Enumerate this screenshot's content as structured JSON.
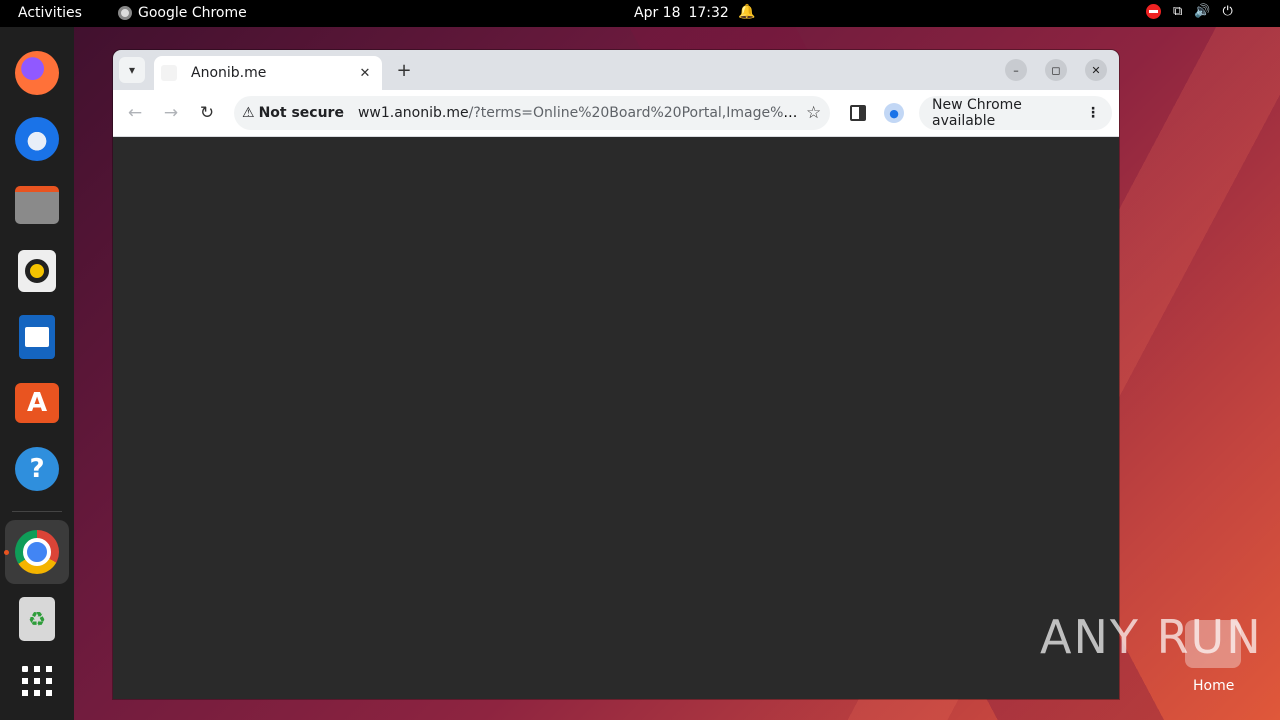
{
  "topbar": {
    "activities": "Activities",
    "app_name": "Google Chrome",
    "date": "Apr 18",
    "time": "17:32"
  },
  "dock": {
    "items": [
      "firefox-icon",
      "thunderbird-icon",
      "files-icon",
      "rhythmbox-icon",
      "writer-icon",
      "app-center-icon",
      "help-icon",
      "chrome-icon",
      "trash-icon",
      "show-apps-icon"
    ]
  },
  "browser": {
    "tab_title": "Anonib.me",
    "security_label": "Not secure",
    "url_host": "ww1.anonib.me",
    "url_path": "/?terms=Online%20Board%20Portal,Image%20Man...",
    "update_label": "New Chrome available"
  },
  "desktop": {
    "watermark": "ANY RUN",
    "home_label": "Home"
  },
  "colors": {
    "accent": "#e95420",
    "chrome_bg": "#dee1e6",
    "page_bg": "#2a2a2a"
  }
}
